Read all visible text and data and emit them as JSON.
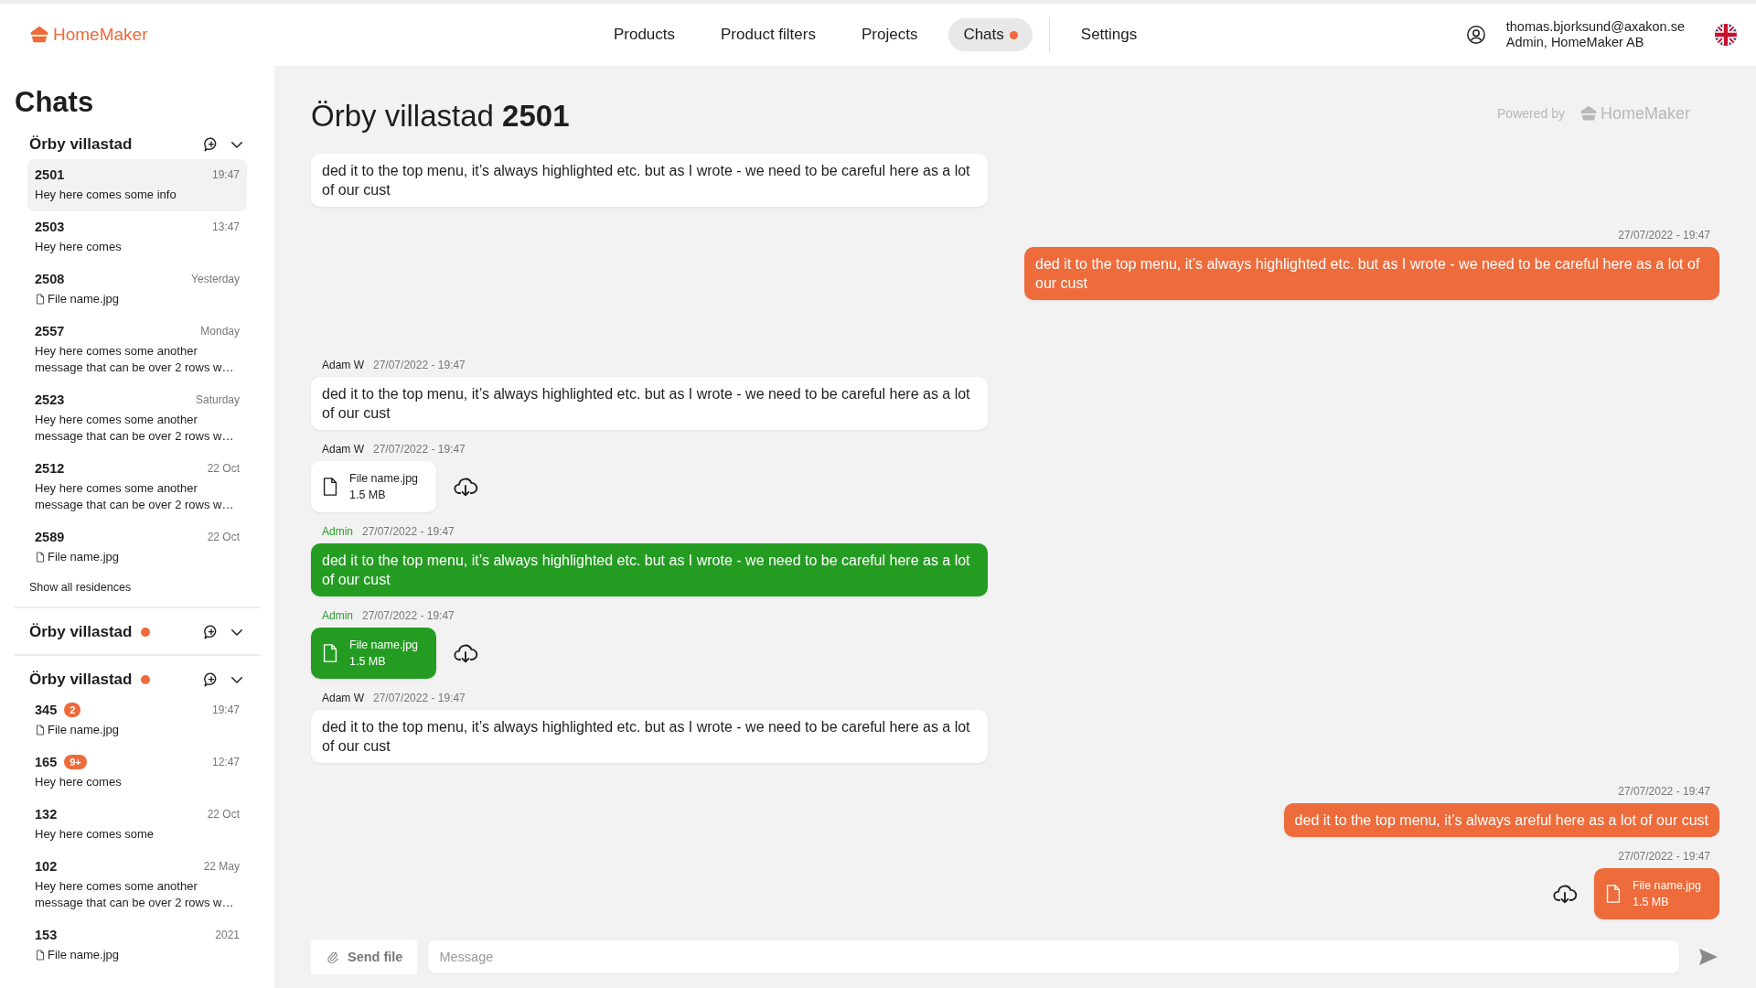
{
  "brand": {
    "name": "HomeMaker"
  },
  "nav": {
    "tabs": [
      {
        "label": "Products",
        "selected": false,
        "notification": false
      },
      {
        "label": "Product filters",
        "selected": false,
        "notification": false
      },
      {
        "label": "Projects",
        "selected": false,
        "notification": false
      },
      {
        "label": "Chats",
        "selected": true,
        "notification": true
      }
    ],
    "secondary": [
      {
        "label": "Settings",
        "selected": false,
        "notification": false
      }
    ]
  },
  "user": {
    "email": "thomas.bjorksund@axakon.se",
    "role": "Admin, HomeMaker AB"
  },
  "sidebar": {
    "title": "Chats",
    "groups": [
      {
        "name": "Örby villastad",
        "unread": false,
        "items": [
          {
            "number": "2501",
            "time": "19:47",
            "preview": "Hey here comes some info",
            "kind": "text",
            "selected": true
          },
          {
            "number": "2503",
            "time": "13:47",
            "preview": "Hey here comes",
            "kind": "text",
            "selected": false
          },
          {
            "number": "2508",
            "time": "Yesterday",
            "preview": "File name.jpg",
            "kind": "file",
            "selected": false
          },
          {
            "number": "2557",
            "time": "Monday",
            "preview": "Hey here comes some another message that can be over 2 rows w…",
            "kind": "text",
            "selected": false
          },
          {
            "number": "2523",
            "time": "Saturday",
            "preview": "Hey here comes some another message that can be over 2 rows w…",
            "kind": "text",
            "selected": false
          },
          {
            "number": "2512",
            "time": "22 Oct",
            "preview": "Hey here comes some another message that can be over 2 rows w…",
            "kind": "text",
            "selected": false
          },
          {
            "number": "2589",
            "time": "22 Oct",
            "preview": "File name.jpg",
            "kind": "file",
            "selected": false
          }
        ],
        "show_all": "Show all residences"
      },
      {
        "name": "Örby villastad",
        "unread": true
      },
      {
        "name": "Örby villastad",
        "unread": true,
        "items": [
          {
            "number": "345",
            "badge": "2",
            "time": "19:47",
            "preview": "File name.jpg",
            "kind": "file",
            "selected": false
          },
          {
            "number": "165",
            "badge": "9+",
            "time": "12:47",
            "preview": "Hey here comes",
            "kind": "text",
            "selected": false
          },
          {
            "number": "132",
            "time": "22 Oct",
            "preview": "Hey here comes some",
            "kind": "text",
            "selected": false
          },
          {
            "number": "102",
            "time": "22 May",
            "preview": "Hey here comes some another message that can be over 2 rows w…",
            "kind": "text",
            "selected": false
          },
          {
            "number": "153",
            "time": "2021",
            "preview": "File name.jpg",
            "kind": "file",
            "selected": false
          }
        ]
      }
    ]
  },
  "chat": {
    "title": "Örby villastad **2501**",
    "powered_by": "Powered by",
    "powered_brand": "HomeMaker",
    "messages": [
      {
        "outgoing": false,
        "admin": false,
        "kind": "text",
        "text": "ded it to the top menu, it’s always highlighted etc. but as I wrote - we need to be careful here as a lot of our cust"
      },
      {
        "outgoing": true,
        "admin": false,
        "kind": "text",
        "time": "27/07/2022 - 19:47",
        "text": "ded it to the top menu, it’s always highlighted etc. but as I wrote - we need to be careful here as a lot of our cust"
      },
      {
        "outgoing": false,
        "admin": false,
        "kind": "text",
        "sender": "Adam W",
        "time": "27/07/2022 - 19:47",
        "text": "ded it to the top menu, it’s always highlighted etc. but as I wrote - we need to be careful here as a lot of our cust"
      },
      {
        "outgoing": false,
        "admin": false,
        "kind": "file",
        "sender": "Adam W",
        "time": "27/07/2022 - 19:47",
        "file": "File name.jpg",
        "size": "1.5 MB"
      },
      {
        "outgoing": false,
        "admin": true,
        "kind": "text",
        "sender": "Admin",
        "time": "27/07/2022 - 19:47",
        "text": "ded it to the top menu, it’s always highlighted etc. but as I wrote - we need to be careful here as a lot of our cust"
      },
      {
        "outgoing": false,
        "admin": true,
        "kind": "file",
        "sender": "Admin",
        "time": "27/07/2022 - 19:47",
        "file": "File name.jpg",
        "size": "1.5 MB"
      },
      {
        "outgoing": false,
        "admin": false,
        "kind": "text",
        "sender": "Adam W",
        "time": "27/07/2022 - 19:47",
        "text": "ded it to the top menu, it’s always highlighted etc. but as I wrote - we need to be careful here as a lot of our cust"
      },
      {
        "outgoing": true,
        "admin": false,
        "kind": "text",
        "time": "27/07/2022 - 19:47",
        "text": "ded it to the top menu, it’s always areful here as a lot of our cust"
      },
      {
        "outgoing": true,
        "admin": false,
        "kind": "file",
        "time": "27/07/2022 - 19:47",
        "file": "File name.jpg",
        "size": "1.5 MB"
      }
    ],
    "composer": {
      "send_file": "Send file",
      "placeholder": "Message"
    }
  }
}
